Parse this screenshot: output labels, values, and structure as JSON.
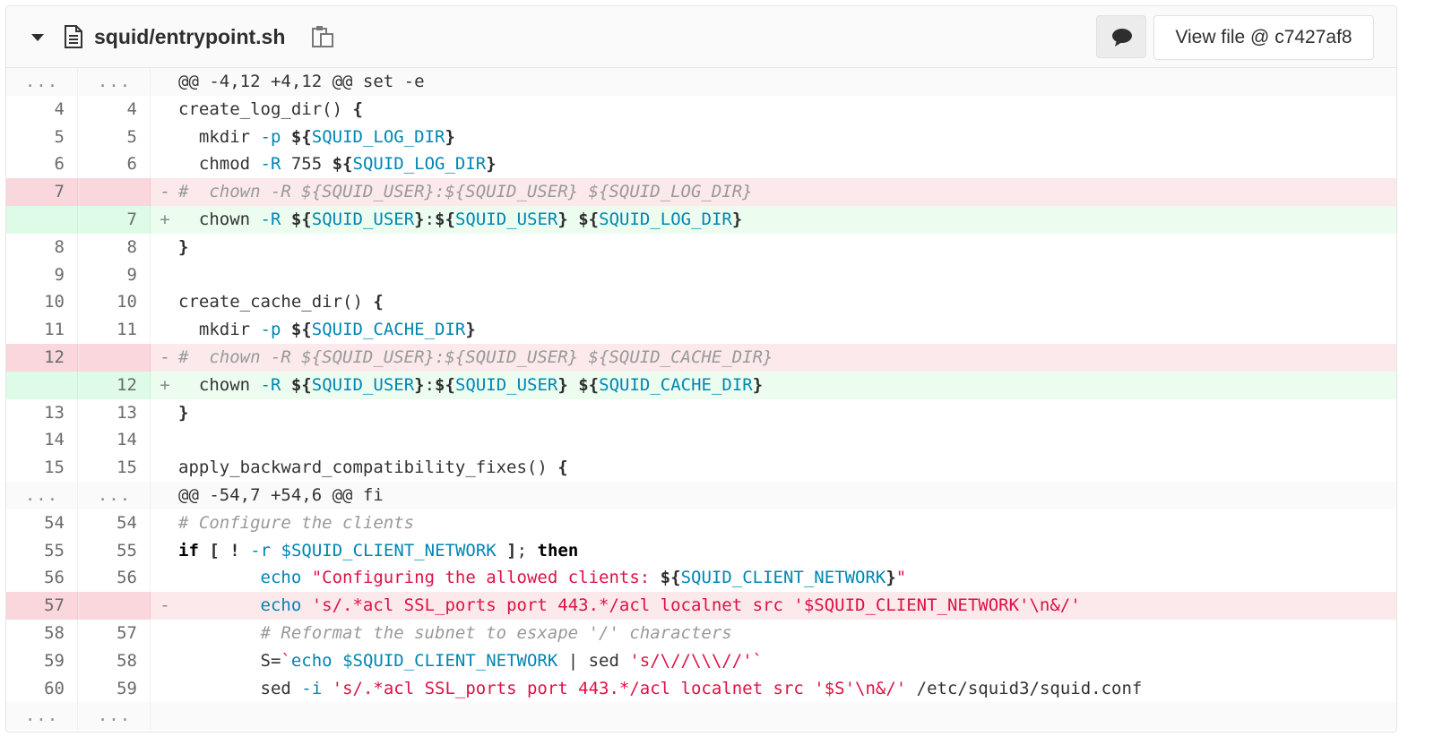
{
  "header": {
    "file_path": "squid/entrypoint.sh",
    "view_file_label": "View file @ c7427af8",
    "icons": {
      "toggle": "chevron-down-icon",
      "file": "file-text-icon",
      "copy": "clipboard-icon",
      "comment": "comment-icon"
    }
  },
  "colors": {
    "removed_line_bg": "#fbe9eb",
    "removed_gutter_bg": "#f9d7dc",
    "added_line_bg": "#ecfdf0",
    "added_gutter_bg": "#ddfbe6",
    "variable": "#0086b3",
    "string": "#dd1144",
    "comment": "#999999"
  },
  "diff": {
    "lines": [
      {
        "type": "match",
        "old": "...",
        "new": "...",
        "marker": "",
        "segments": [
          {
            "t": "o",
            "v": "@@ -4,12 +4,12 @@ set -e"
          }
        ]
      },
      {
        "type": "context",
        "old": "4",
        "new": "4",
        "marker": "",
        "segments": [
          {
            "t": "o",
            "v": "create_log_dir() "
          },
          {
            "t": "b",
            "v": "{"
          }
        ]
      },
      {
        "type": "context",
        "old": "5",
        "new": "5",
        "marker": "",
        "segments": [
          {
            "t": "o",
            "v": "  mkdir "
          },
          {
            "t": "v",
            "v": "-p"
          },
          {
            "t": "o",
            "v": " "
          },
          {
            "t": "b",
            "v": "${"
          },
          {
            "t": "v",
            "v": "SQUID_LOG_DIR"
          },
          {
            "t": "b",
            "v": "}"
          }
        ]
      },
      {
        "type": "context",
        "old": "6",
        "new": "6",
        "marker": "",
        "segments": [
          {
            "t": "o",
            "v": "  chmod "
          },
          {
            "t": "v",
            "v": "-R"
          },
          {
            "t": "o",
            "v": " 755 "
          },
          {
            "t": "b",
            "v": "${"
          },
          {
            "t": "v",
            "v": "SQUID_LOG_DIR"
          },
          {
            "t": "b",
            "v": "}"
          }
        ]
      },
      {
        "type": "old",
        "old": "7",
        "new": "",
        "marker": "-",
        "segments": [
          {
            "t": "c",
            "v": "#  chown -R ${SQUID_USER}:${SQUID_USER} ${SQUID_LOG_DIR}"
          }
        ]
      },
      {
        "type": "new",
        "old": "",
        "new": "7",
        "marker": "+",
        "segments": [
          {
            "t": "o",
            "v": "  chown "
          },
          {
            "t": "v",
            "v": "-R"
          },
          {
            "t": "o",
            "v": " "
          },
          {
            "t": "b",
            "v": "${"
          },
          {
            "t": "v",
            "v": "SQUID_USER"
          },
          {
            "t": "b",
            "v": "}"
          },
          {
            "t": "o",
            "v": ":"
          },
          {
            "t": "b",
            "v": "${"
          },
          {
            "t": "v",
            "v": "SQUID_USER"
          },
          {
            "t": "b",
            "v": "}"
          },
          {
            "t": "o",
            "v": " "
          },
          {
            "t": "b",
            "v": "${"
          },
          {
            "t": "v",
            "v": "SQUID_LOG_DIR"
          },
          {
            "t": "b",
            "v": "}"
          }
        ]
      },
      {
        "type": "context",
        "old": "8",
        "new": "8",
        "marker": "",
        "segments": [
          {
            "t": "b",
            "v": "}"
          }
        ]
      },
      {
        "type": "context",
        "old": "9",
        "new": "9",
        "marker": "",
        "segments": []
      },
      {
        "type": "context",
        "old": "10",
        "new": "10",
        "marker": "",
        "segments": [
          {
            "t": "o",
            "v": "create_cache_dir() "
          },
          {
            "t": "b",
            "v": "{"
          }
        ]
      },
      {
        "type": "context",
        "old": "11",
        "new": "11",
        "marker": "",
        "segments": [
          {
            "t": "o",
            "v": "  mkdir "
          },
          {
            "t": "v",
            "v": "-p"
          },
          {
            "t": "o",
            "v": " "
          },
          {
            "t": "b",
            "v": "${"
          },
          {
            "t": "v",
            "v": "SQUID_CACHE_DIR"
          },
          {
            "t": "b",
            "v": "}"
          }
        ]
      },
      {
        "type": "old",
        "old": "12",
        "new": "",
        "marker": "-",
        "segments": [
          {
            "t": "c",
            "v": "#  chown -R ${SQUID_USER}:${SQUID_USER} ${SQUID_CACHE_DIR}"
          }
        ]
      },
      {
        "type": "new",
        "old": "",
        "new": "12",
        "marker": "+",
        "segments": [
          {
            "t": "o",
            "v": "  chown "
          },
          {
            "t": "v",
            "v": "-R"
          },
          {
            "t": "o",
            "v": " "
          },
          {
            "t": "b",
            "v": "${"
          },
          {
            "t": "v",
            "v": "SQUID_USER"
          },
          {
            "t": "b",
            "v": "}"
          },
          {
            "t": "o",
            "v": ":"
          },
          {
            "t": "b",
            "v": "${"
          },
          {
            "t": "v",
            "v": "SQUID_USER"
          },
          {
            "t": "b",
            "v": "}"
          },
          {
            "t": "o",
            "v": " "
          },
          {
            "t": "b",
            "v": "${"
          },
          {
            "t": "v",
            "v": "SQUID_CACHE_DIR"
          },
          {
            "t": "b",
            "v": "}"
          }
        ]
      },
      {
        "type": "context",
        "old": "13",
        "new": "13",
        "marker": "",
        "segments": [
          {
            "t": "b",
            "v": "}"
          }
        ]
      },
      {
        "type": "context",
        "old": "14",
        "new": "14",
        "marker": "",
        "segments": []
      },
      {
        "type": "context",
        "old": "15",
        "new": "15",
        "marker": "",
        "segments": [
          {
            "t": "o",
            "v": "apply_backward_compatibility_fixes() "
          },
          {
            "t": "b",
            "v": "{"
          }
        ]
      },
      {
        "type": "match",
        "old": "...",
        "new": "...",
        "marker": "",
        "segments": [
          {
            "t": "o",
            "v": "@@ -54,7 +54,6 @@ fi"
          }
        ]
      },
      {
        "type": "context",
        "old": "54",
        "new": "54",
        "marker": "",
        "segments": [
          {
            "t": "c",
            "v": "# Configure the clients"
          }
        ]
      },
      {
        "type": "context",
        "old": "55",
        "new": "55",
        "marker": "",
        "segments": [
          {
            "t": "k",
            "v": "if"
          },
          {
            "t": "o",
            "v": " "
          },
          {
            "t": "b",
            "v": "["
          },
          {
            "t": "o",
            "v": " "
          },
          {
            "t": "b",
            "v": "!"
          },
          {
            "t": "o",
            "v": " "
          },
          {
            "t": "v",
            "v": "-r"
          },
          {
            "t": "o",
            "v": " "
          },
          {
            "t": "v",
            "v": "$SQUID_CLIENT_NETWORK"
          },
          {
            "t": "o",
            "v": " "
          },
          {
            "t": "b",
            "v": "]"
          },
          {
            "t": "o",
            "v": "; "
          },
          {
            "t": "k",
            "v": "then"
          }
        ]
      },
      {
        "type": "context",
        "old": "56",
        "new": "56",
        "marker": "",
        "segments": [
          {
            "t": "o",
            "v": "        "
          },
          {
            "t": "v",
            "v": "echo"
          },
          {
            "t": "o",
            "v": " "
          },
          {
            "t": "s",
            "v": "\"Configuring the allowed clients: "
          },
          {
            "t": "b",
            "v": "${"
          },
          {
            "t": "v",
            "v": "SQUID_CLIENT_NETWORK"
          },
          {
            "t": "b",
            "v": "}"
          },
          {
            "t": "s",
            "v": "\""
          }
        ]
      },
      {
        "type": "old",
        "old": "57",
        "new": "",
        "marker": "-",
        "segments": [
          {
            "t": "o",
            "v": "        "
          },
          {
            "t": "v",
            "v": "echo"
          },
          {
            "t": "o",
            "v": " "
          },
          {
            "t": "s",
            "v": "'s/.*acl SSL_ports port 443.*/acl localnet src '"
          },
          {
            "t": "s",
            "v": "$SQUID_CLIENT_NETWORK"
          },
          {
            "t": "s",
            "v": "'\\n&/'"
          }
        ]
      },
      {
        "type": "context",
        "old": "58",
        "new": "57",
        "marker": "",
        "segments": [
          {
            "t": "o",
            "v": "        "
          },
          {
            "t": "c",
            "v": "# Reformat the subnet to esxape '/' characters"
          }
        ]
      },
      {
        "type": "context",
        "old": "59",
        "new": "58",
        "marker": "",
        "segments": [
          {
            "t": "o",
            "v": "        S="
          },
          {
            "t": "s",
            "v": "`"
          },
          {
            "t": "v",
            "v": "echo"
          },
          {
            "t": "o",
            "v": " "
          },
          {
            "t": "v",
            "v": "$SQUID_CLIENT_NETWORK"
          },
          {
            "t": "o",
            "v": " | sed "
          },
          {
            "t": "s",
            "v": "'s/\\//\\\\\\//'`"
          }
        ]
      },
      {
        "type": "context",
        "old": "60",
        "new": "59",
        "marker": "",
        "segments": [
          {
            "t": "o",
            "v": "        sed "
          },
          {
            "t": "v",
            "v": "-i"
          },
          {
            "t": "o",
            "v": " "
          },
          {
            "t": "s",
            "v": "'s/.*acl SSL_ports port 443.*/acl localnet src '"
          },
          {
            "t": "s",
            "v": "$S"
          },
          {
            "t": "s",
            "v": "'\\n&/'"
          },
          {
            "t": "o",
            "v": " /etc/squid3/squid.conf"
          }
        ]
      },
      {
        "type": "match-end",
        "old": "...",
        "new": "...",
        "marker": "",
        "segments": []
      }
    ]
  }
}
